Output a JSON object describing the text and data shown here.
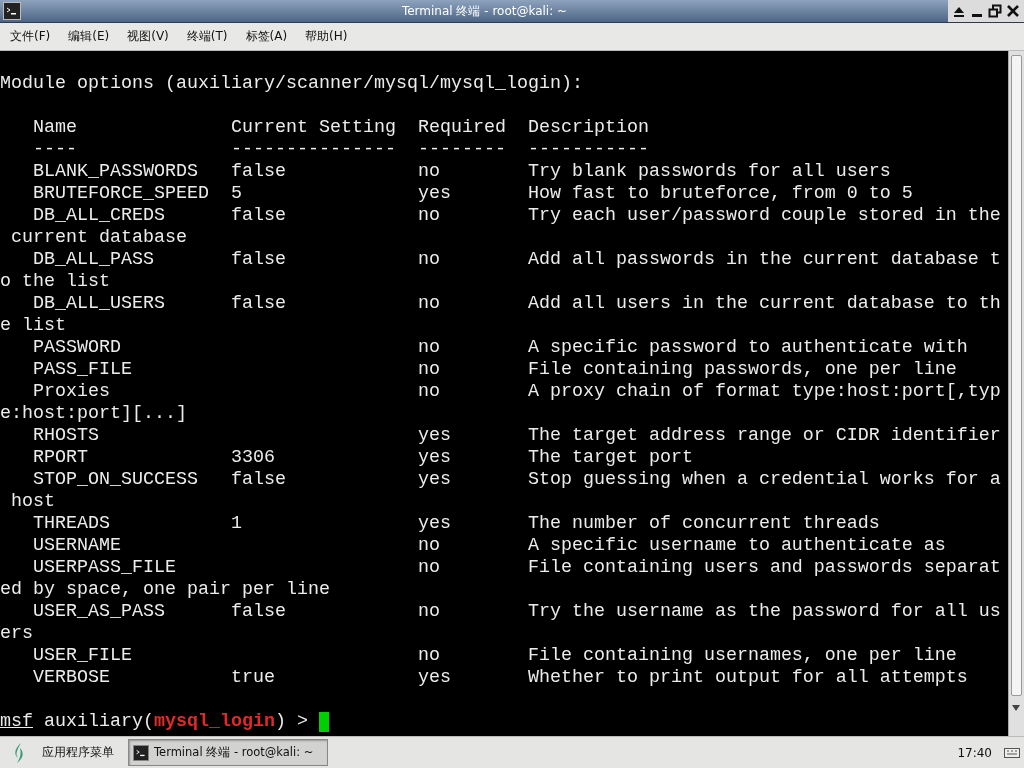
{
  "window": {
    "title": "Terminal 终端 - root@kali: ~"
  },
  "menu": [
    "文件(F)",
    "编辑(E)",
    "视图(V)",
    "终端(T)",
    "标签(A)",
    "帮助(H)"
  ],
  "terminal": {
    "heading": "Module options (auxiliary/scanner/mysql/mysql_login):",
    "columns": [
      "Name",
      "Current Setting",
      "Required",
      "Description"
    ],
    "rules": [
      "----",
      "---------------",
      "--------",
      "-----------"
    ],
    "rows": [
      {
        "name": "BLANK_PASSWORDS",
        "setting": "false",
        "required": "no",
        "description": "Try blank passwords for all users"
      },
      {
        "name": "BRUTEFORCE_SPEED",
        "setting": "5",
        "required": "yes",
        "description": "How fast to bruteforce, from 0 to 5"
      },
      {
        "name": "DB_ALL_CREDS",
        "setting": "false",
        "required": "no",
        "description": "Try each user/password couple stored in the",
        "wrap": " current database"
      },
      {
        "name": "DB_ALL_PASS",
        "setting": "false",
        "required": "no",
        "description": "Add all passwords in the current database t",
        "wrap": "o the list"
      },
      {
        "name": "DB_ALL_USERS",
        "setting": "false",
        "required": "no",
        "description": "Add all users in the current database to th",
        "wrap": "e list"
      },
      {
        "name": "PASSWORD",
        "required": "no",
        "description": "A specific password to authenticate with"
      },
      {
        "name": "PASS_FILE",
        "required": "no",
        "description": "File containing passwords, one per line"
      },
      {
        "name": "Proxies",
        "required": "no",
        "description": "A proxy chain of format type:host:port[,typ",
        "wrap": "e:host:port][...]"
      },
      {
        "name": "RHOSTS",
        "required": "yes",
        "description": "The target address range or CIDR identifier"
      },
      {
        "name": "RPORT",
        "setting": "3306",
        "required": "yes",
        "description": "The target port"
      },
      {
        "name": "STOP_ON_SUCCESS",
        "setting": "false",
        "required": "yes",
        "description": "Stop guessing when a credential works for a",
        "wrap": " host"
      },
      {
        "name": "THREADS",
        "setting": "1",
        "required": "yes",
        "description": "The number of concurrent threads"
      },
      {
        "name": "USERNAME",
        "required": "no",
        "description": "A specific username to authenticate as"
      },
      {
        "name": "USERPASS_FILE",
        "required": "no",
        "description": "File containing users and passwords separat",
        "wrap": "ed by space, one pair per line"
      },
      {
        "name": "USER_AS_PASS",
        "setting": "false",
        "required": "no",
        "description": "Try the username as the password for all us",
        "wrap": "ers"
      },
      {
        "name": "USER_FILE",
        "required": "no",
        "description": "File containing usernames, one per line"
      },
      {
        "name": "VERBOSE",
        "setting": "true",
        "required": "yes",
        "description": "Whether to print output for all attempts"
      }
    ],
    "prompt": {
      "shell": "msf",
      "prefix": " auxiliary(",
      "module": "mysql_login",
      "suffix": ") > "
    }
  },
  "taskbar": {
    "app_menu": "应用程序菜单",
    "tasks": [
      {
        "label": "Terminal 终端 - root@kali: ~",
        "selected": true
      }
    ],
    "clock": "17:40"
  }
}
